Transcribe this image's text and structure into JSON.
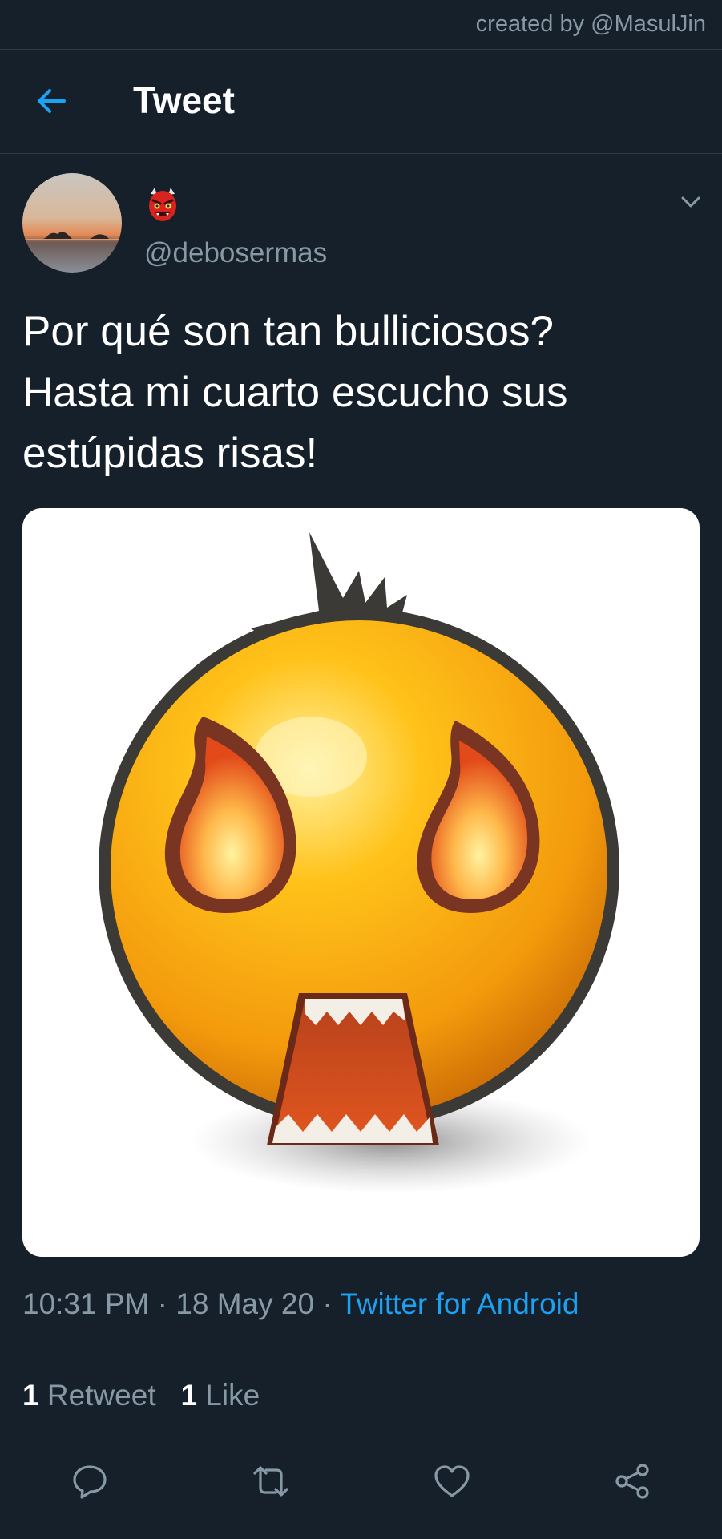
{
  "credit": {
    "text": "created by @MasulJin"
  },
  "header": {
    "title": "Tweet"
  },
  "tweet": {
    "handle": "@debosermas",
    "display_name_icon": "japanese-ogre-emoji",
    "text_lines": [
      "Por qué son tan bulliciosos?",
      "Hasta mi cuarto escucho sus",
      "estúpidas risas!"
    ],
    "media_icon": "angry-fire-eyes-emoji",
    "time": "10:31 PM",
    "separator": "·",
    "date": "18 May 20",
    "source": "Twitter for Android"
  },
  "stats": {
    "retweets_count": "1",
    "retweets_label": "Retweet",
    "likes_count": "1",
    "likes_label": "Like"
  },
  "actions": [
    "reply-icon",
    "retweet-icon",
    "like-icon",
    "share-icon"
  ],
  "colors": {
    "background": "#15202b",
    "secondary_text": "#8899a6",
    "accent": "#1da1f2",
    "divider": "#2f3b47"
  }
}
